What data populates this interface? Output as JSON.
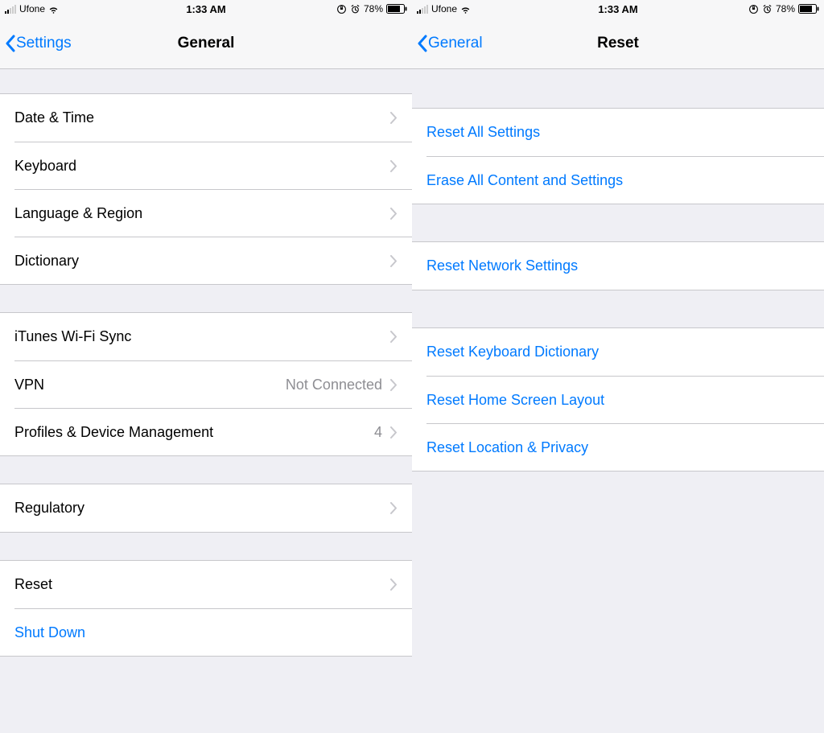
{
  "statusbar": {
    "carrier": "Ufone",
    "time": "1:33 AM",
    "battery_pct": "78%"
  },
  "left": {
    "back_label": "Settings",
    "title": "General",
    "groups": [
      {
        "rows": [
          {
            "label": "Date & Time",
            "detail": "",
            "chevron": true,
            "blue": false
          },
          {
            "label": "Keyboard",
            "detail": "",
            "chevron": true,
            "blue": false
          },
          {
            "label": "Language & Region",
            "detail": "",
            "chevron": true,
            "blue": false
          },
          {
            "label": "Dictionary",
            "detail": "",
            "chevron": true,
            "blue": false
          }
        ]
      },
      {
        "rows": [
          {
            "label": "iTunes Wi-Fi Sync",
            "detail": "",
            "chevron": true,
            "blue": false
          },
          {
            "label": "VPN",
            "detail": "Not Connected",
            "chevron": true,
            "blue": false
          },
          {
            "label": "Profiles & Device Management",
            "detail": "4",
            "chevron": true,
            "blue": false
          }
        ]
      },
      {
        "rows": [
          {
            "label": "Regulatory",
            "detail": "",
            "chevron": true,
            "blue": false
          }
        ]
      },
      {
        "rows": [
          {
            "label": "Reset",
            "detail": "",
            "chevron": true,
            "blue": false
          },
          {
            "label": "Shut Down",
            "detail": "",
            "chevron": false,
            "blue": true
          }
        ]
      }
    ]
  },
  "right": {
    "back_label": "General",
    "title": "Reset",
    "groups": [
      {
        "rows": [
          {
            "label": "Reset All Settings",
            "blue": true
          },
          {
            "label": "Erase All Content and Settings",
            "blue": true
          }
        ]
      },
      {
        "rows": [
          {
            "label": "Reset Network Settings",
            "blue": true
          }
        ]
      },
      {
        "rows": [
          {
            "label": "Reset Keyboard Dictionary",
            "blue": true
          },
          {
            "label": "Reset Home Screen Layout",
            "blue": true
          },
          {
            "label": "Reset Location & Privacy",
            "blue": true
          }
        ]
      }
    ]
  }
}
